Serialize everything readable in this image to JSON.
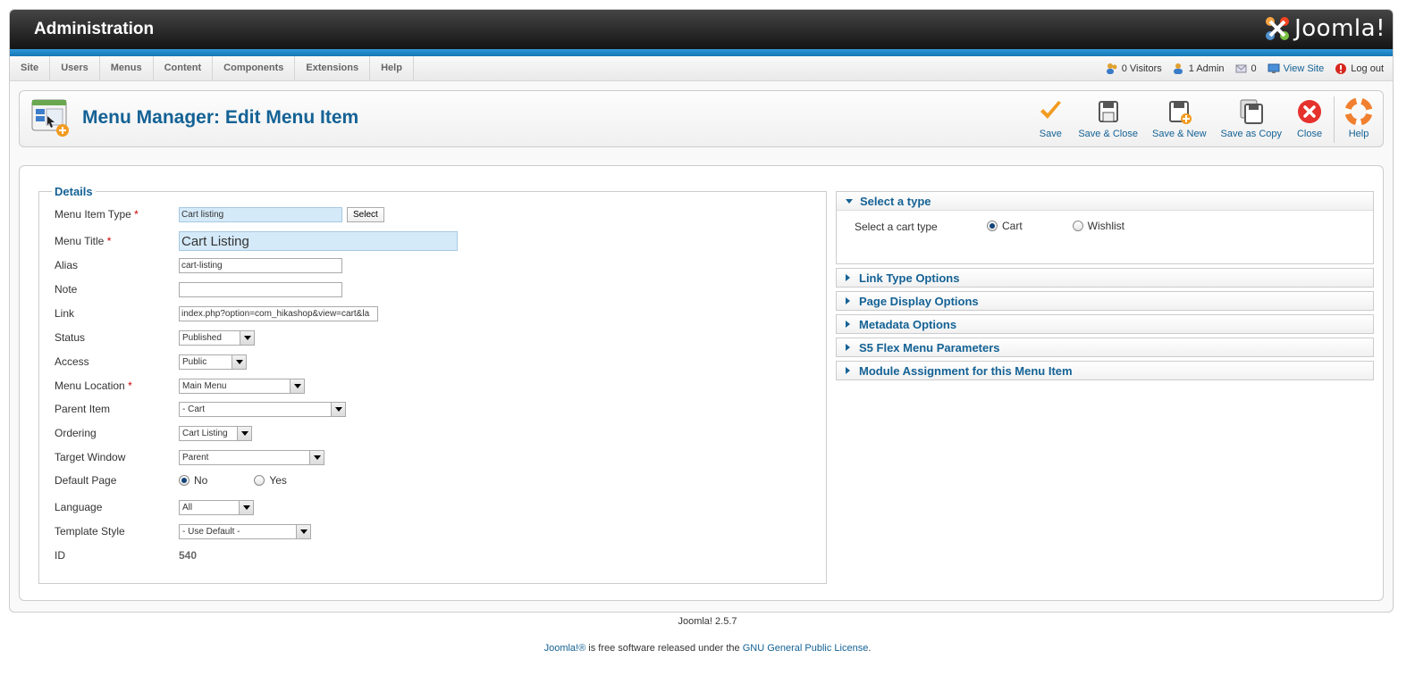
{
  "header": {
    "title": "Administration",
    "logo_text": "Joomla!"
  },
  "menubar": {
    "items": [
      "Site",
      "Users",
      "Menus",
      "Content",
      "Components",
      "Extensions",
      "Help"
    ]
  },
  "status": {
    "visitors": "0 Visitors",
    "admins": "1 Admin",
    "messages": "0",
    "view_site": "View Site",
    "logout": "Log out"
  },
  "page": {
    "title": "Menu Manager: Edit Menu Item"
  },
  "toolbar": {
    "save": "Save",
    "save_close": "Save & Close",
    "save_new": "Save & New",
    "save_copy": "Save as Copy",
    "close": "Close",
    "help": "Help"
  },
  "details": {
    "legend": "Details",
    "menu_item_type_label": "Menu Item Type",
    "menu_item_type_value": "Cart listing",
    "select_button": "Select",
    "menu_title_label": "Menu Title",
    "menu_title_value": "Cart Listing",
    "alias_label": "Alias",
    "alias_value": "cart-listing",
    "note_label": "Note",
    "note_value": "",
    "link_label": "Link",
    "link_value": "index.php?option=com_hikashop&view=cart&la",
    "status_label": "Status",
    "status_value": "Published",
    "access_label": "Access",
    "access_value": "Public",
    "menu_location_label": "Menu Location",
    "menu_location_value": "Main Menu",
    "parent_item_label": "Parent Item",
    "parent_item_value": "- Cart",
    "ordering_label": "Ordering",
    "ordering_value": "Cart Listing",
    "target_window_label": "Target Window",
    "target_window_value": "Parent",
    "default_page_label": "Default Page",
    "default_page_no": "No",
    "default_page_yes": "Yes",
    "language_label": "Language",
    "language_value": "All",
    "template_style_label": "Template Style",
    "template_style_value": "- Use Default -",
    "id_label": "ID",
    "id_value": "540",
    "required_mark": "*"
  },
  "panes": {
    "select_type": {
      "title": "Select a type",
      "field_label": "Select a cart type",
      "option_cart": "Cart",
      "option_wishlist": "Wishlist"
    },
    "link_type": "Link Type Options",
    "page_display": "Page Display Options",
    "metadata": "Metadata Options",
    "s5_flex": "S5 Flex Menu Parameters",
    "module_assignment": "Module Assignment for this Menu Item"
  },
  "footer": {
    "version": "Joomla! 2.5.7",
    "joomla_link": "Joomla!®",
    "license_text_1": " is free software released under the ",
    "license_link": "GNU General Public License",
    "license_text_2": "."
  },
  "colors": {
    "brand_blue": "#146295",
    "header_dark": "#1a1a1a",
    "strip_blue": "#1e86c6",
    "required_red": "#cc0000",
    "highlight_field": "#d5eaf9"
  },
  "icons": {
    "logo": "joomla-logo-icon",
    "visitors": "users-icon",
    "admin": "admin-icon",
    "messages": "messages-icon",
    "view_site": "monitor-icon",
    "logout": "logout-icon",
    "page": "menu-manager-icon",
    "save": "checkmark-icon",
    "save_close": "floppy-icon",
    "save_new": "floppy-plus-icon",
    "save_copy": "floppy-copy-icon",
    "close": "close-circle-icon",
    "help": "lifebuoy-icon"
  }
}
